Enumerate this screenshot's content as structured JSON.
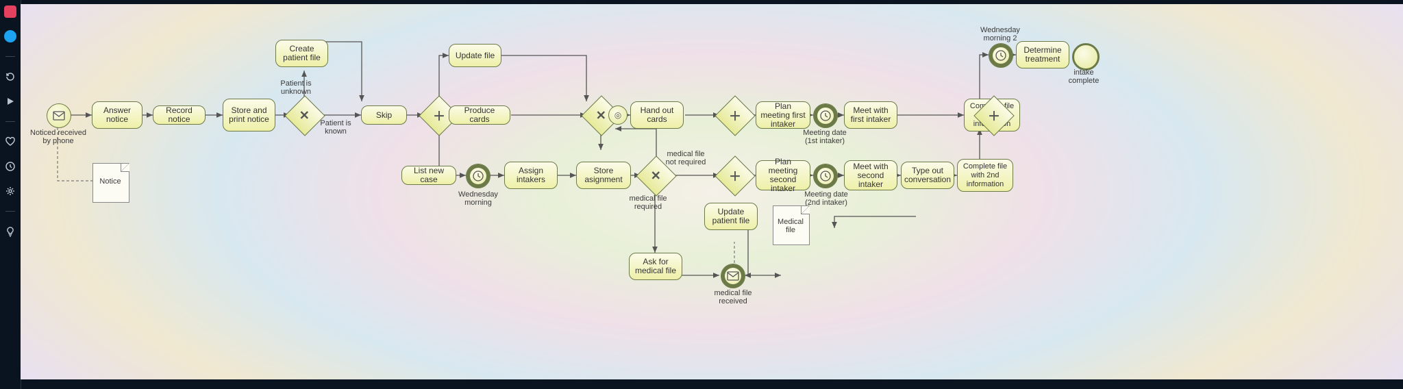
{
  "diagram_type": "BPMN process diagram",
  "sidebar": {
    "items": [
      "instagram",
      "twitter",
      "restore",
      "play",
      "heart",
      "clock",
      "gear",
      "bulb"
    ]
  },
  "start_event": {
    "label": "Noticed received by phone",
    "icon": "envelope"
  },
  "tasks": {
    "answer_notice": "Answer notice",
    "record_notice": "Record notice",
    "store_print": "Store and print notice",
    "create_patient_file": "Create patient file",
    "skip": "Skip",
    "update_file": "Update file",
    "produce_cards": "Produce cards",
    "list_new_case": "List new case",
    "assign_intakers": "Assign intakers",
    "store_assignment": "Store asignment",
    "hand_out_cards": "Hand out cards",
    "plan_meeting_first": "Plan meeting first intaker",
    "meet_first": "Meet with first intaker",
    "complete_file_1st": "Complete file with 1st information",
    "plan_meeting_second": "Plan meeting second intaker",
    "meet_second": "Meet with second intaker",
    "type_out": "Type out conversation",
    "complete_file_2nd": "Complete file with 2nd information",
    "update_patient_file": "Update patient file",
    "ask_medical": "Ask for medical file",
    "determine_treatment": "Determine treatment"
  },
  "gateway_labels": {
    "g1_top": "Patient is unknown",
    "g1_bottom": "Patient is known",
    "g4_top": "medical file not required",
    "g4_bottom": "medical file required"
  },
  "timer_labels": {
    "wed_morning": "Wednesday morning",
    "meeting_1st": "Meeting date (1st intaker)",
    "meeting_2nd": "Meeting date (2nd intaker)",
    "wed_morning_2": "Wednesday morning 2"
  },
  "message_labels": {
    "medical_received": "medical file received"
  },
  "data_objects": {
    "notice": "Notice",
    "medical_file": "Medical file"
  },
  "end_event": {
    "label": "intake complete"
  },
  "colors": {
    "task_border": "#6b7a47",
    "task_fill_top": "#fbfbe8",
    "task_fill_bottom": "#eef0a8"
  }
}
